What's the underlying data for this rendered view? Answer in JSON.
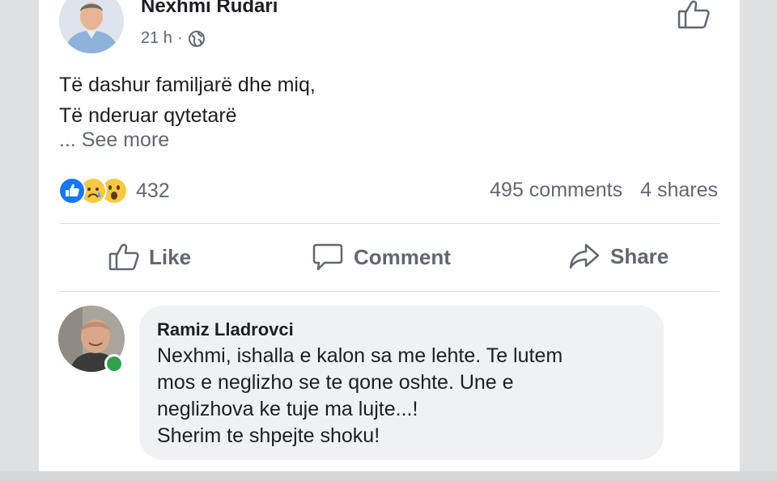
{
  "post": {
    "author": "Nexhmi Rudari",
    "time": "21 h",
    "separator": "·",
    "privacy_icon": "globe-icon",
    "text_lines": [
      "Të dashur familjarë dhe miq,",
      "Të nderuar qytetarë"
    ],
    "see_more": "... See more"
  },
  "stats": {
    "reaction_icons": [
      "like-reaction-icon",
      "sad-reaction-icon",
      "wow-reaction-icon"
    ],
    "reaction_count": "432",
    "comments": "495 comments",
    "shares": "4 shares"
  },
  "actions": {
    "like": "Like",
    "comment": "Comment",
    "share": "Share"
  },
  "comment": {
    "author": "Ramiz Lladrovci",
    "online": true,
    "lines": [
      "Nexhmi, ishalla e kalon sa me lehte. Te lutem",
      "mos e neglizho se te qone oshte. Une e",
      "neglizhova ke tuje ma lujte...!",
      "Sherim te shpejte shoku!"
    ]
  },
  "colors": {
    "facebook_blue": "#1877f2",
    "online_green": "#31a24c",
    "secondary_text": "#606770",
    "bubble": "#eff1f4"
  }
}
